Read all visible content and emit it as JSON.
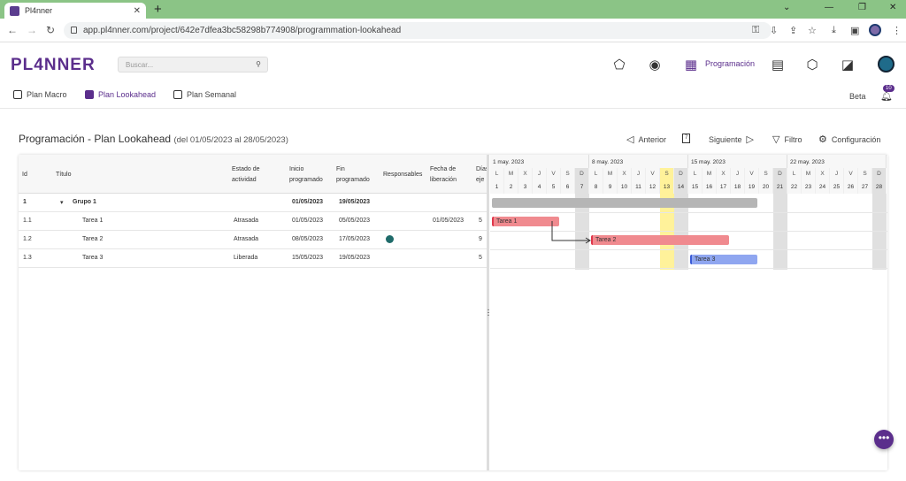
{
  "browser": {
    "tab_title": "Pl4nner",
    "url": "app.pl4nner.com/project/642e7dfea3bc58298b774908/programmation-lookahead"
  },
  "header": {
    "logo": "PL4NNER",
    "search_placeholder": "Buscar...",
    "active_section": "Programación",
    "beta": "Beta",
    "notifications": "10"
  },
  "subnav": [
    "Plan Macro",
    "Plan Lookahead",
    "Plan Semanal"
  ],
  "page": {
    "title": "Programación - Plan Lookahead",
    "range": "(del 01/05/2023 al 28/05/2023)",
    "toolbar": {
      "prev": "Anterior",
      "next": "Siguiente",
      "filter": "Filtro",
      "config": "Configuración",
      "cal_day": "7"
    }
  },
  "grid": {
    "headers": {
      "id": "Id",
      "title": "Título",
      "status": "Estado de actividad",
      "start": "Inicio programado",
      "end": "Fin programado",
      "resp": "Responsables",
      "release": "Fecha de liberación",
      "days": "Días eje"
    },
    "rows": [
      {
        "id": "1",
        "title": "Grupo 1",
        "status": "",
        "start": "01/05/2023",
        "end": "19/05/2023",
        "release": "",
        "days": ""
      },
      {
        "id": "1.1",
        "title": "Tarea 1",
        "status": "Atrasada",
        "start": "01/05/2023",
        "end": "05/05/2023",
        "release": "01/05/2023",
        "days": "5"
      },
      {
        "id": "1.2",
        "title": "Tarea 2",
        "status": "Atrasada",
        "start": "08/05/2023",
        "end": "17/05/2023",
        "release": "",
        "days": "9"
      },
      {
        "id": "1.3",
        "title": "Tarea 3",
        "status": "Liberada",
        "start": "15/05/2023",
        "end": "19/05/2023",
        "release": "",
        "days": "5"
      }
    ]
  },
  "gantt": {
    "weeks": [
      "1 may. 2023",
      "8 may. 2023",
      "15 may. 2023",
      "22 may. 2023"
    ],
    "day_letters": [
      "L",
      "M",
      "X",
      "J",
      "V",
      "S",
      "D"
    ],
    "bars": {
      "t1": "Tarea 1",
      "t2": "Tarea 2",
      "t3": "Tarea 3"
    },
    "colors": {
      "group": "#b5b5b5",
      "late": "#f08a8f",
      "released": "#8fa6f0",
      "today": "#fff29a",
      "weekend": "#e0e0e0"
    }
  }
}
